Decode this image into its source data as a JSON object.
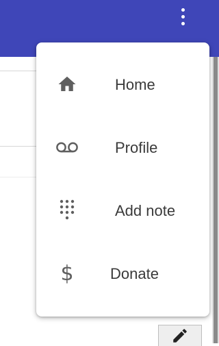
{
  "app_bar": {
    "color": "#3f46b8",
    "overflow_icon": "more-vert-icon"
  },
  "menu": {
    "items": [
      {
        "label": "Home",
        "icon": "home-icon"
      },
      {
        "label": "Profile",
        "icon": "voicemail-icon"
      },
      {
        "label": "Add note",
        "icon": "dialpad-icon"
      },
      {
        "label": "Donate",
        "icon": "dollar-icon"
      }
    ]
  },
  "fab": {
    "icon": "pencil-icon"
  }
}
